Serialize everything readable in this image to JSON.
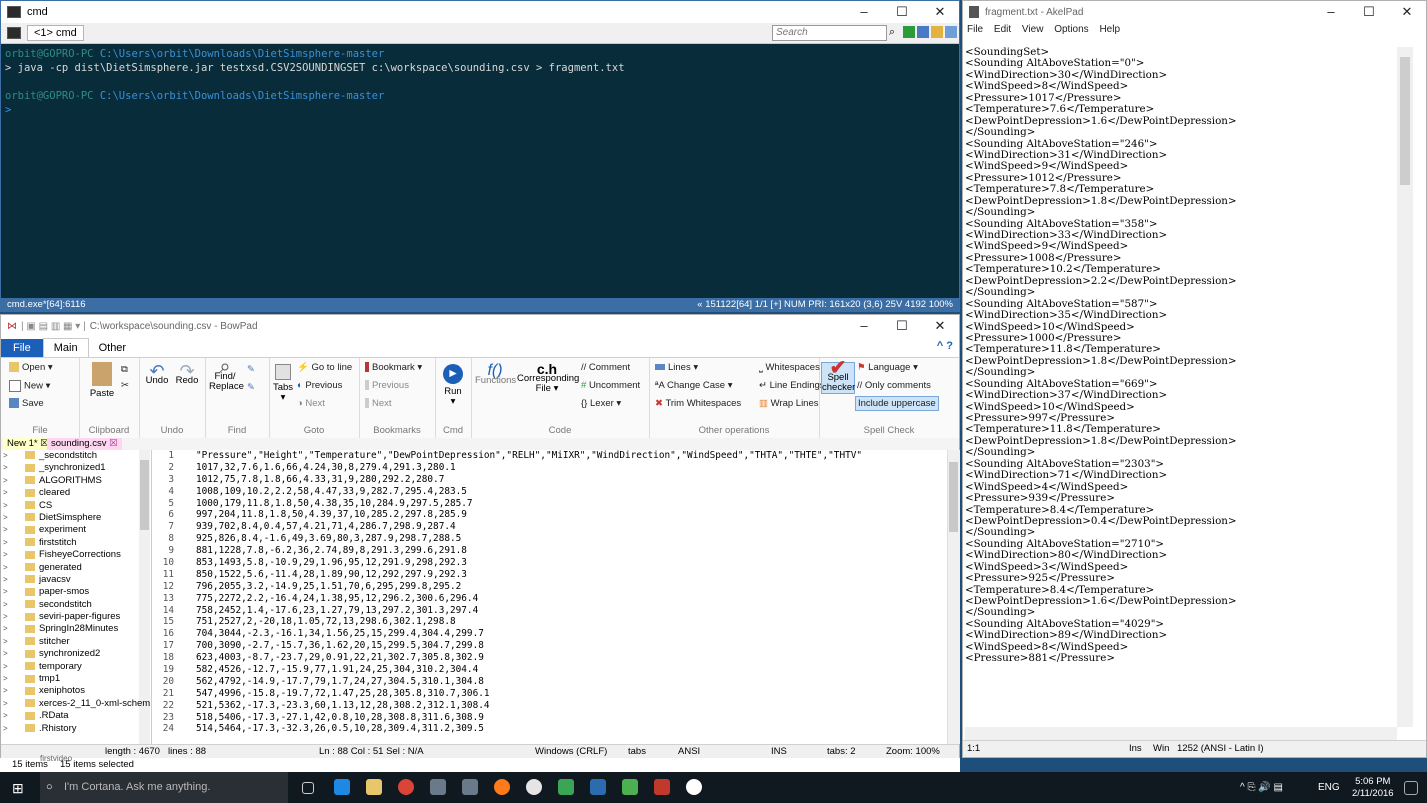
{
  "cmd": {
    "title": "cmd",
    "tab_label": "<1> cmd",
    "search_placeholder": "Search",
    "prompt_user": "orbit@GOPRO-PC",
    "path": "C:\\Users\\orbit\\Downloads\\DietSimsphere-master",
    "command": "> java -cp dist\\DietSimsphere.jar testxsd.CSV2SOUNDINGSET c:\\workspace\\sounding.csv  > fragment.txt",
    "prompt_char": ">",
    "status_left": "cmd.exe*[64]:6116",
    "status_right": "« 151122[64]  1/1  [+] NUM  PRI:  161x20    (3,6) 25V     4192  100%"
  },
  "bowpad": {
    "title": "C:\\workspace\\sounding.csv - BowPad",
    "menu": {
      "file": "File",
      "main": "Main",
      "other": "Other"
    },
    "ribbon": {
      "open": "Open",
      "new": "New",
      "save": "Save",
      "paste": "Paste",
      "undo": "Undo",
      "redo": "Redo",
      "find_replace": "Find/\nReplace",
      "tabs": "Tabs",
      "goto_line": "Go to line",
      "previous": "Previous",
      "next": "Next",
      "bookmark": "Bookmark",
      "bm_previous": "Previous",
      "bm_next": "Next",
      "run": "Run",
      "functions": "Functions",
      "corresponding": "Corresponding\nFile",
      "comment": "// Comment",
      "uncomment": "Uncomment",
      "lexer": "Lexer",
      "lines": "Lines",
      "change_case": "Change Case",
      "trim_ws": "Trim Whitespaces",
      "whitespaces": "Whitespaces",
      "line_endings": "Line Endings",
      "wrap_lines": "Wrap Lines",
      "spell_checker": "Spell\nchecker",
      "language": "Language",
      "only_comments": "// Only comments",
      "include_uppercase": "Include uppercase",
      "groups": [
        "File",
        "Clipboard",
        "Undo",
        "Find",
        "Goto",
        "Bookmarks",
        "Cmd",
        "Code",
        "Other operations",
        "Spell Check"
      ]
    },
    "doc_tabs": [
      "New 1*",
      "sounding.csv"
    ],
    "tree": [
      "_secondstitch",
      "_synchronized1",
      "ALGORITHMS",
      "cleared",
      "CS",
      "DietSimsphere",
      "experiment",
      "firststitch",
      "FisheyeCorrections",
      "generated",
      "javacsv",
      "paper-smos",
      "secondstitch",
      "seviri-paper-figures",
      "SpringIn28Minutes",
      "stitcher",
      "synchronized2",
      "temporary",
      "tmp1",
      "xeniphotos",
      "xerces-2_11_0-xml-schem",
      ".RData",
      ".Rhistory"
    ],
    "lines": [
      "\"Pressure\",\"Height\",\"Temperature\",\"DewPointDepression\",\"RELH\",\"MiIXR\",\"WindDirection\",\"WindSpeed\",\"THTA\",\"THTE\",\"THTV\"",
      "1017,32,7.6,1.6,66,4.24,30,8,279.4,291.3,280.1",
      "1012,75,7.8,1.8,66,4.33,31,9,280,292.2,280.7",
      "1008,109,10.2,2.2,58,4.47,33,9,282.7,295.4,283.5",
      "1000,179,11.8,1.8,50,4.38,35,10,284.9,297.5,285.7",
      "997,204,11.8,1.8,50,4.39,37,10,285.2,297.8,285.9",
      "939,702,8.4,0.4,57,4.21,71,4,286.7,298.9,287.4",
      "925,826,8.4,-1.6,49,3.69,80,3,287.9,298.7,288.5",
      "881,1228,7.8,-6.2,36,2.74,89,8,291.3,299.6,291.8",
      "853,1493,5.8,-10.9,29,1.96,95,12,291.9,298,292.3",
      "850,1522,5.6,-11.4,28,1.89,90,12,292,297.9,292.3",
      "796,2055,3.2,-14.9,25,1.51,70,6,295,299.8,295.2",
      "775,2272,2.2,-16.4,24,1.38,95,12,296.2,300.6,296.4",
      "758,2452,1.4,-17.6,23,1.27,79,13,297.2,301.3,297.4",
      "751,2527,2,-20,18,1.05,72,13,298.6,302.1,298.8",
      "704,3044,-2.3,-16.1,34,1.56,25,15,299.4,304.4,299.7",
      "700,3090,-2.7,-15.7,36,1.62,20,15,299.5,304.7,299.8",
      "623,4003,-8.7,-23.7,29,0.91,22,21,302.7,305.8,302.9",
      "582,4526,-12.7,-15.9,77,1.91,24,25,304,310.2,304.4",
      "562,4792,-14.9,-17.7,79,1.7,24,27,304.5,310.1,304.8",
      "547,4996,-15.8,-19.7,72,1.47,25,28,305.8,310.7,306.1",
      "521,5362,-17.3,-23.3,60,1.13,12,28,308.2,312.1,308.4",
      "518,5406,-17.3,-27.1,42,0.8,10,28,308.8,311.6,308.9",
      "514,5464,-17.3,-32.3,26,0.5,10,28,309.4,311.2,309.5"
    ],
    "status": {
      "length": "length : 4670",
      "lines": "lines : 88",
      "pos": "Ln : 88   Col : 51   Sel : N/A",
      "eol": "Windows (CRLF)",
      "tabs": "tabs",
      "encoding": "ANSI",
      "ins": "INS",
      "tabsize": "tabs: 2",
      "zoom": "Zoom: 100%"
    }
  },
  "explorer": {
    "items": "15 items",
    "selected": "15 items selected",
    "partial": "firstvideo"
  },
  "akelpad": {
    "title": "fragment.txt - AkelPad",
    "menu": [
      "File",
      "Edit",
      "View",
      "Options",
      "Help"
    ],
    "lines": [
      "<SoundingSet>",
      "<Sounding AltAboveStation=\"0\">",
      "<WindDirection>30</WindDirection>",
      "<WindSpeed>8</WindSpeed>",
      "<Pressure>1017</Pressure>",
      "<Temperature>7.6</Temperature>",
      "<DewPointDepression>1.6</DewPointDepression>",
      "</Sounding>",
      "<Sounding AltAboveStation=\"246\">",
      "<WindDirection>31</WindDirection>",
      "<WindSpeed>9</WindSpeed>",
      "<Pressure>1012</Pressure>",
      "<Temperature>7.8</Temperature>",
      "<DewPointDepression>1.8</DewPointDepression>",
      "</Sounding>",
      "<Sounding AltAboveStation=\"358\">",
      "<WindDirection>33</WindDirection>",
      "<WindSpeed>9</WindSpeed>",
      "<Pressure>1008</Pressure>",
      "<Temperature>10.2</Temperature>",
      "<DewPointDepression>2.2</DewPointDepression>",
      "</Sounding>",
      "<Sounding AltAboveStation=\"587\">",
      "<WindDirection>35</WindDirection>",
      "<WindSpeed>10</WindSpeed>",
      "<Pressure>1000</Pressure>",
      "<Temperature>11.8</Temperature>",
      "<DewPointDepression>1.8</DewPointDepression>",
      "</Sounding>",
      "<Sounding AltAboveStation=\"669\">",
      "<WindDirection>37</WindDirection>",
      "<WindSpeed>10</WindSpeed>",
      "<Pressure>997</Pressure>",
      "<Temperature>11.8</Temperature>",
      "<DewPointDepression>1.8</DewPointDepression>",
      "</Sounding>",
      "<Sounding AltAboveStation=\"2303\">",
      "<WindDirection>71</WindDirection>",
      "<WindSpeed>4</WindSpeed>",
      "<Pressure>939</Pressure>",
      "<Temperature>8.4</Temperature>",
      "<DewPointDepression>0.4</DewPointDepression>",
      "</Sounding>",
      "<Sounding AltAboveStation=\"2710\">",
      "<WindDirection>80</WindDirection>",
      "<WindSpeed>3</WindSpeed>",
      "<Pressure>925</Pressure>",
      "<Temperature>8.4</Temperature>",
      "<DewPointDepression>1.6</DewPointDepression>",
      "</Sounding>",
      "<Sounding AltAboveStation=\"4029\">",
      "<WindDirection>89</WindDirection>",
      "<WindSpeed>8</WindSpeed>",
      "<Pressure>881</Pressure>"
    ],
    "status": {
      "pos": "1:1",
      "ins": "Ins",
      "eol": "Win",
      "codepage": "1252  (ANSI - Latin I)"
    }
  },
  "taskbar": {
    "cortana": "I'm Cortana. Ask me anything.",
    "lang": "ENG",
    "time": "5:06 PM",
    "date": "2/11/2016"
  },
  "colors": {
    "console_bg": "#082c3a",
    "accent": "#1c5fb8",
    "taskbar": "#101820"
  }
}
